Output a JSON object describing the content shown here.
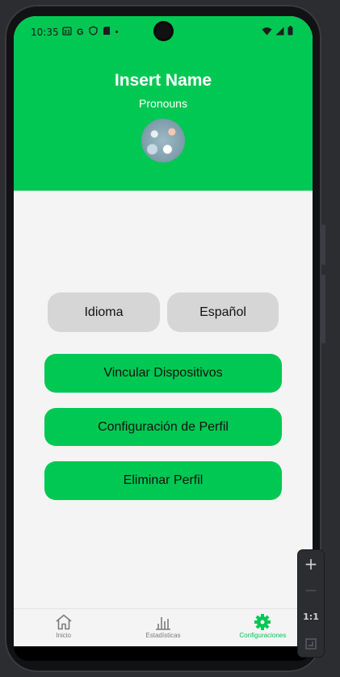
{
  "status_bar": {
    "time": "10:35",
    "left_icons": [
      "31",
      "G",
      "shield",
      "sd-card",
      "•"
    ],
    "right_icons": [
      "wifi-icon",
      "signal-icon",
      "battery-icon"
    ]
  },
  "profile": {
    "name": "Insert Name",
    "pronouns": "Pronouns"
  },
  "language": {
    "label": "Idioma",
    "value": "Español"
  },
  "actions": {
    "link_devices": "Vincular Dispositivos",
    "profile_settings": "Configuración de Perfil",
    "delete_profile": "Eliminar Perfil"
  },
  "bottom_nav": {
    "home": "Inicio",
    "stats": "Estadísticas",
    "settings": "Configuraciones",
    "active": "settings"
  },
  "emulator_toolbar": {
    "zoom_in": "+",
    "zoom_out": "—",
    "ratio": "1:1"
  },
  "colors": {
    "accent": "#00c853",
    "background": "#f4f4f4",
    "pill_gray": "#d6d6d6"
  }
}
